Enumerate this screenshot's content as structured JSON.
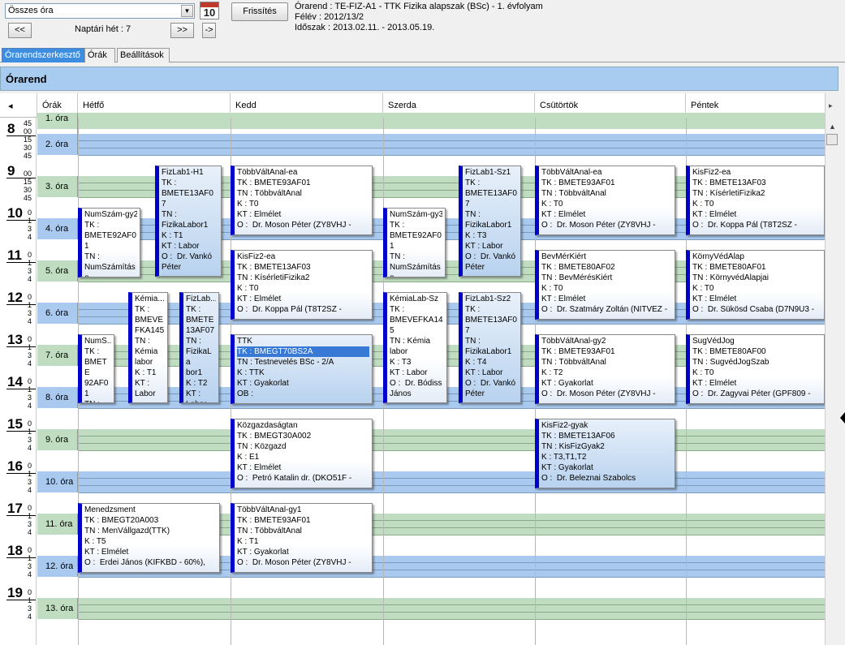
{
  "toolbar": {
    "combo_value": "Összes óra",
    "calendar_day": "10",
    "refresh_label": "Frissítés",
    "prev_label": "<<",
    "week_label": "Naptári hét : 7",
    "next_label": ">>",
    "jump_label": "->"
  },
  "info": {
    "line1": "Órarend : TE-FIZ-A1 - TTK Fizika alapszak (BSc) - 1. évfolyam",
    "line2": "Félév : 2012/13/2",
    "line3": "Időszak : 2013.02.11. - 2013.05.19."
  },
  "tabs": [
    "Órarendszerkesztő",
    "Órák",
    "Beállítások"
  ],
  "panel_title": "Órarend",
  "grid": {
    "left_arrow": "◂",
    "right_arrow": "▸",
    "ora_header": "Órák",
    "days": [
      "Hétfő",
      "Kedd",
      "Szerda",
      "Csütörtök",
      "Péntek"
    ],
    "hours": [
      "8",
      "9",
      "10",
      "11",
      "12",
      "13",
      "14",
      "15",
      "16",
      "17",
      "18",
      "19"
    ],
    "minute_ticks_a": [
      "45",
      "00",
      "15",
      "30",
      "45"
    ],
    "minute_ticks_b": [
      "0",
      "1",
      "3",
      "4"
    ],
    "oras": [
      "1. óra",
      "2. óra",
      "3. óra",
      "4. óra",
      "5. óra",
      "6. óra",
      "7. óra",
      "8. óra",
      "9. óra",
      "10. óra",
      "11. óra",
      "12. óra",
      "13. óra"
    ]
  },
  "events": [
    {
      "title": "FizLab1-H1",
      "body": "TK :\nBMETE13AF0\n7\nTN :\nFizikaLabor1\nK : T1\nKT : Labor\nO :  Dr. Vankó\nPéter",
      "sel": true
    },
    {
      "title": "NumSzám-gy2",
      "body": "TK :\nBMETE92AF0\n1\nTN :\nNumSzámításo",
      "sel": false
    },
    {
      "title": "Kémia...",
      "body": "TK :\nBMEVE\nFKA145\nTN :\nKémia\nlabor\nK : T1\nKT :\nLabor",
      "sel": false
    },
    {
      "title": "FizLab...",
      "body": "TK :\nBMETE\n13AF07\nTN :\nFizikaLa\nbor1\nK : T2\nKT :\nLabor",
      "sel": true
    },
    {
      "title": "NumS...",
      "body": "TK :\nBMETE\n92AF01\nTN :\nNumSzá",
      "sel": false
    },
    {
      "title": "Menedzsment",
      "body": "TK : BMEGT20A003\nTN : MenVállgazd(TTK)\nK : T5\nKT : Elmélet\nO :  Erdei János (KIFKBD - 60%),",
      "sel": false
    },
    {
      "title": "TöbbVáltAnal-ea",
      "body": "TK : BMETE93AF01\nTN : TöbbváltAnal\nK : T0\nKT : Elmélet\nO :  Dr. Moson Péter (ZY8VHJ -",
      "sel": false
    },
    {
      "title": "KisFiz2-ea",
      "body": "TK : BMETE13AF03\nTN : KísérletiFizika2\nK : T0\nKT : Elmélet\nO :  Dr. Koppa Pál (T8T2SZ -",
      "sel": false
    },
    {
      "title": "TTK",
      "body": "TN : Testnevelés BSc - 2/A\nK : TTK\nKT : Gyakorlat\nOB :",
      "hl": "TK : BMEGT70BS2A",
      "sel": true
    },
    {
      "title": "Közgazdaságtan",
      "body": "TK : BMEGT30A002\nTN : Közgazd\nK : E1\nKT : Elmélet\nO :  Petró Katalin dr. (DKO51F -",
      "sel": false
    },
    {
      "title": "TöbbVáltAnal-gy1",
      "body": "TK : BMETE93AF01\nTN : TöbbváltAnal\nK : T1\nKT : Gyakorlat\nO :  Dr. Moson Péter (ZY8VHJ -",
      "sel": false
    },
    {
      "title": "FizLab1-Sz1",
      "body": "TK :\nBMETE13AF0\n7\nTN :\nFizikaLabor1\nK : T3\nKT : Labor\nO :  Dr. Vankó\nPéter",
      "sel": true
    },
    {
      "title": "NumSzám-gy3",
      "body": "TK :\nBMETE92AF0\n1\nTN :\nNumSzámításo",
      "sel": false
    },
    {
      "title": "KémiaLab-Sz",
      "body": "TK :\nBMEVEFKA14\n5\nTN : Kémia\nlabor\nK : T3\nKT : Labor\nO :  Dr. Bódiss\nJános",
      "sel": false
    },
    {
      "title": "FizLab1-Sz2",
      "body": "TK :\nBMETE13AF0\n7\nTN :\nFizikaLabor1\nK : T4\nKT : Labor\nO :  Dr. Vankó\nPéter",
      "sel": true
    },
    {
      "title": "TöbbVáltAnal-ea",
      "body": "TK : BMETE93AF01\nTN : TöbbváltAnal\nK : T0\nKT : Elmélet\nO :  Dr. Moson Péter (ZY8VHJ -",
      "sel": false
    },
    {
      "title": "BevMérKiért",
      "body": "TK : BMETE80AF02\nTN : BevMérésKiért\nK : T0\nKT : Elmélet\nO :  Dr. Szatmáry Zoltán (NITVEZ -",
      "sel": false
    },
    {
      "title": "TöbbVáltAnal-gy2",
      "body": "TK : BMETE93AF01\nTN : TöbbváltAnal\nK : T2\nKT : Gyakorlat\nO :  Dr. Moson Péter (ZY8VHJ -",
      "sel": false
    },
    {
      "title": "KisFiz2-gyak",
      "body": "TK : BMETE13AF06\nTN : KisFizGyak2\nK : T3,T1,T2\nKT : Gyakorlat\nO :  Dr. Beleznai Szabolcs",
      "sel": true
    },
    {
      "title": "KisFiz2-ea",
      "body": "TK : BMETE13AF03\nTN : KísérletiFizika2\nK : T0\nKT : Elmélet\nO :  Dr. Koppa Pál (T8T2SZ -",
      "sel": false
    },
    {
      "title": "KörnyVédAlap",
      "body": "TK : BMETE80AF01\nTN : KörnyvédAlapjai\nK : T0\nKT : Elmélet\nO :  Dr. Sükösd Csaba (D7N9U3 -",
      "sel": false
    },
    {
      "title": "SugVédJog",
      "body": "TK : BMETE80AF00\nTN : SugvédJogSzab\nK : T0\nKT : Elmélet\nO :  Dr. Zagyvai Péter (GPF809 -",
      "sel": false
    }
  ]
}
